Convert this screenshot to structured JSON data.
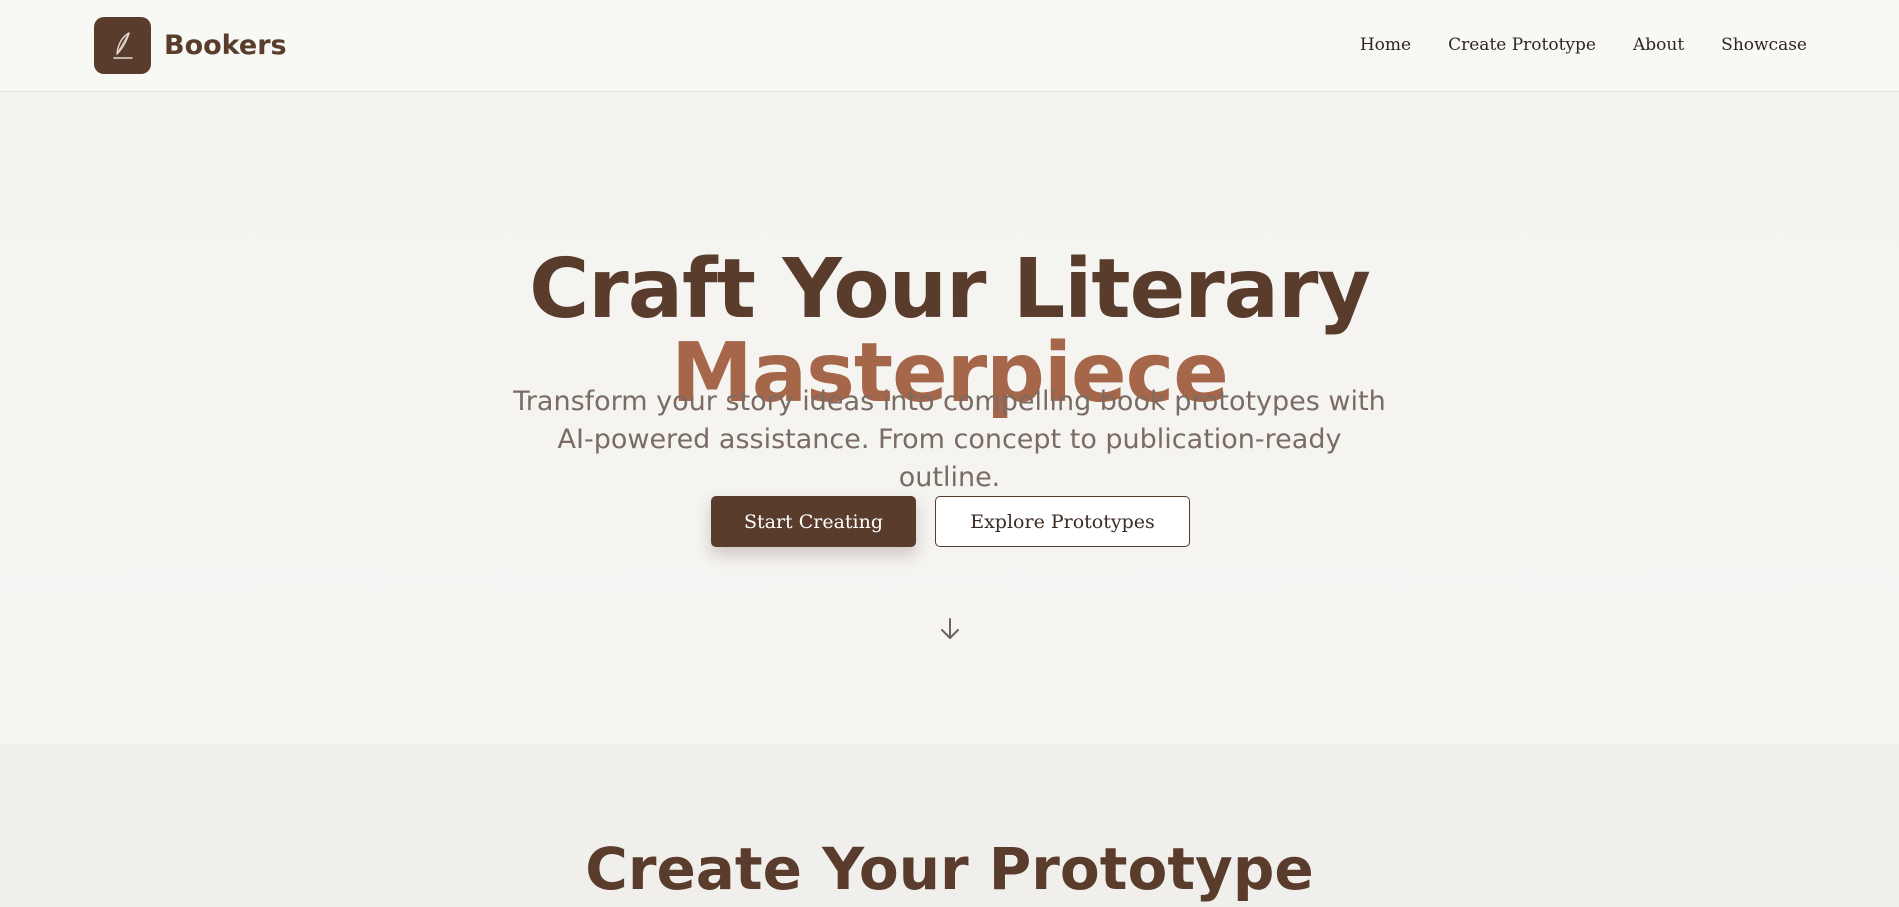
{
  "brand": {
    "name": "Bookers",
    "logo_icon": "quill-pen-icon"
  },
  "nav": {
    "items": [
      {
        "label": "Home"
      },
      {
        "label": "Create Prototype"
      },
      {
        "label": "About"
      },
      {
        "label": "Showcase"
      }
    ]
  },
  "hero": {
    "title_line1": "Craft Your Literary",
    "title_line2": "Masterpiece",
    "subtitle": "Transform your story ideas into compelling book prototypes with AI-powered assistance. From concept to publication-ready outline.",
    "primary_button": "Start Creating",
    "secondary_button": "Explore Prototypes",
    "scroll_icon": "arrow-down-icon"
  },
  "section_create": {
    "title": "Create Your Prototype"
  },
  "colors": {
    "brand_brown": "#5a3c2c",
    "accent_terracotta": "#a5664a",
    "subtitle_gray": "#7b6c63",
    "background": "#f5f4f1"
  }
}
